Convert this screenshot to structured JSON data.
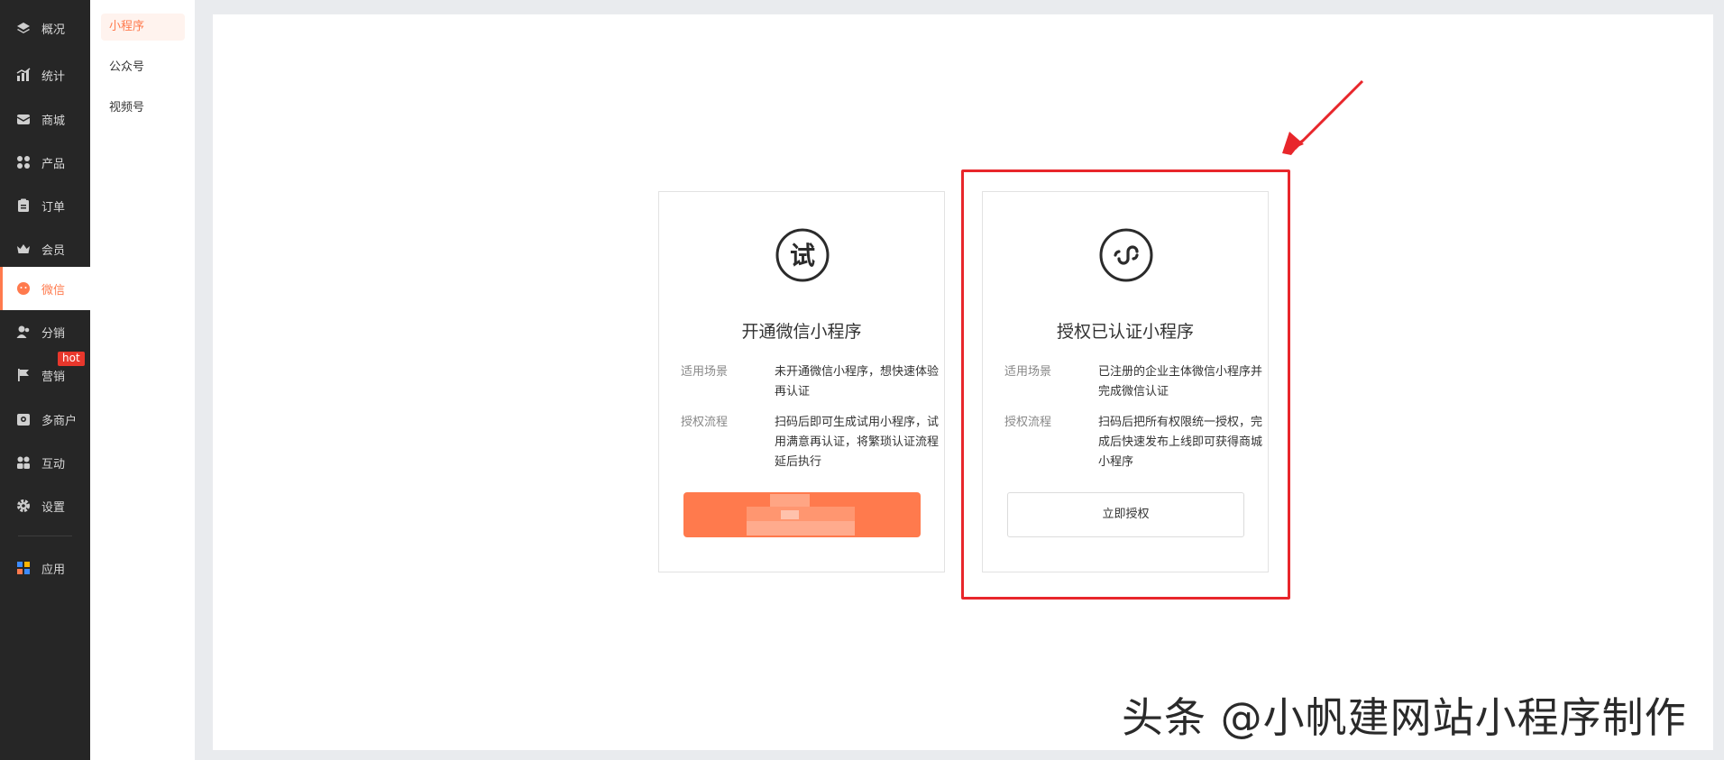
{
  "sidebar": {
    "items": [
      {
        "label": "概况",
        "icon": "layers-icon"
      },
      {
        "label": "统计",
        "icon": "chart-icon"
      },
      {
        "label": "商城",
        "icon": "mail-box-icon"
      },
      {
        "label": "产品",
        "icon": "grid-icon"
      },
      {
        "label": "订单",
        "icon": "clipboard-icon"
      },
      {
        "label": "会员",
        "icon": "crown-icon"
      },
      {
        "label": "微信",
        "icon": "wechat-icon"
      },
      {
        "label": "分销",
        "icon": "users-icon"
      },
      {
        "label": "营销",
        "icon": "flag-icon"
      },
      {
        "label": "多商户",
        "icon": "store-icon"
      },
      {
        "label": "互动",
        "icon": "people-icon"
      },
      {
        "label": "设置",
        "icon": "gear-icon"
      },
      {
        "label": "应用",
        "icon": "apps-icon"
      }
    ],
    "active_index": 6,
    "hot_badge": "hot"
  },
  "subnav": {
    "items": [
      {
        "label": "小程序"
      },
      {
        "label": "公众号"
      },
      {
        "label": "视频号"
      }
    ],
    "active_index": 0
  },
  "cards": [
    {
      "icon_char": "试",
      "title": "开通微信小程序",
      "rows": [
        {
          "key": "适用场景",
          "value": "未开通微信小程序，想快速体验再认证"
        },
        {
          "key": "授权流程",
          "value": "扫码后即可生成试用小程序，试用满意再认证，将繁琐认证流程延后执行"
        }
      ],
      "button_label": ""
    },
    {
      "title": "授权已认证小程序",
      "rows": [
        {
          "key": "适用场景",
          "value": "已注册的企业主体微信小程序并完成微信认证"
        },
        {
          "key": "授权流程",
          "value": "扫码后把所有权限统一授权，完成后快速发布上线即可获得商城小程序"
        }
      ],
      "button_label": "立即授权"
    }
  ],
  "watermark": "头条 @小帆建网站小程序制作",
  "colors": {
    "accent": "#ff7a4d",
    "sidebar_bg": "#262626",
    "highlight": "#e8262b"
  }
}
